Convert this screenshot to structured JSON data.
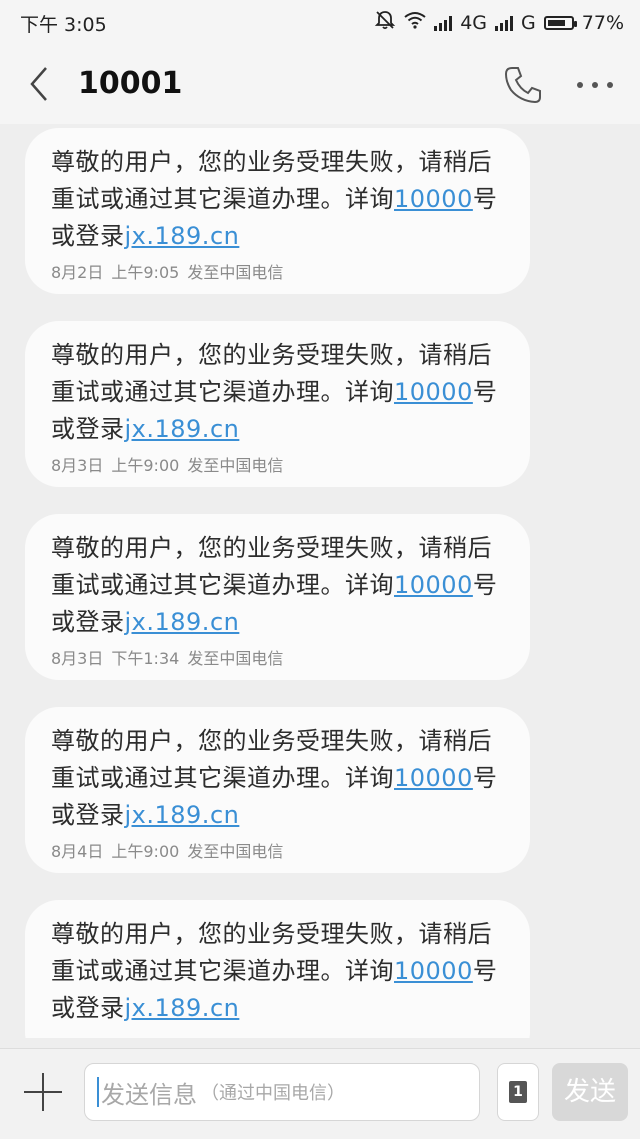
{
  "status_bar": {
    "time": "下午 3:05",
    "network1": "4G",
    "network2": "G",
    "battery": "77%",
    "battery_level": 0.77
  },
  "header": {
    "title": "10001"
  },
  "messages": [
    {
      "text_a": "尊敬的用户，您的业务受理失败，请稍后重试或通过其它渠道办理。详询",
      "link1": "10000",
      "text_b": "号或登录",
      "link2": "jx.189.cn",
      "date": "8月2日",
      "time": "上午9:05",
      "via": "发至中国电信"
    },
    {
      "text_a": "尊敬的用户，您的业务受理失败，请稍后重试或通过其它渠道办理。详询",
      "link1": "10000",
      "text_b": "号或登录",
      "link2": "jx.189.cn",
      "date": "8月3日",
      "time": "上午9:00",
      "via": "发至中国电信"
    },
    {
      "text_a": "尊敬的用户，您的业务受理失败，请稍后重试或通过其它渠道办理。详询",
      "link1": "10000",
      "text_b": "号或登录",
      "link2": "jx.189.cn",
      "date": "8月3日",
      "time": "下午1:34",
      "via": "发至中国电信"
    },
    {
      "text_a": "尊敬的用户，您的业务受理失败，请稍后重试或通过其它渠道办理。详询",
      "link1": "10000",
      "text_b": "号或登录",
      "link2": "jx.189.cn",
      "date": "8月4日",
      "time": "上午9:00",
      "via": "发至中国电信"
    },
    {
      "text_a": "尊敬的用户，您的业务受理失败，请稍后重试或通过其它渠道办理。详询",
      "link1": "10000",
      "text_b": "号或登录",
      "link2": "jx.189.cn"
    }
  ],
  "compose": {
    "placeholder_main": "发送信息",
    "placeholder_sub": "（通过中国电信）",
    "sim_label": "1",
    "send_label": "发送"
  },
  "icons": {
    "back": "back-arrow-icon",
    "phone": "phone-icon",
    "more": "more-dots-icon",
    "plus": "plus-icon",
    "sim": "sim-card-icon"
  }
}
